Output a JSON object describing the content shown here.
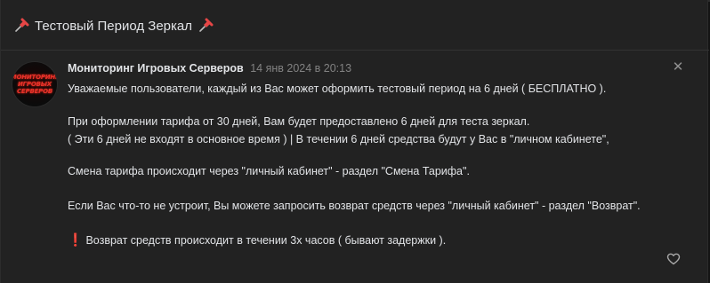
{
  "post": {
    "title": "Тестовый Период Зеркал",
    "author": "Мониторинг Игровых Серверов",
    "date": "14 янв 2024 в 20:13",
    "avatar_lines": [
      "МОНИТОРИНГ",
      "ИГРОВЫХ",
      "СЕРВЕРОВ"
    ],
    "lines": [
      "Уважаемые пользователи, каждый из Вас может оформить тестовый период на 6 дней ( БЕСПЛАТНО ).",
      "При оформлении тарифа от 30 дней, Вам будет предоставлено 6 дней для теста зеркал.",
      "( Эти 6 дней не входят в основное время ) | В течении 6 дней средства будут у Вас в \"личном кабинете\",",
      "Смена тарифа происходит через \"личный кабинет\" - раздел \"Смена Тарифа\".",
      "Если Вас что-то не устроит, Вы можете запросить возврат средств через \"личный кабинет\" - раздел \"Возврат\".",
      "Возврат средств происходит в течении 3х часов ( бывают задержки )."
    ],
    "warning_mark": "❗",
    "close_glyph": "✕"
  },
  "icons": {
    "pin": "pushpin-icon",
    "close": "close-icon",
    "like": "heart-icon",
    "warning": "exclamation-icon"
  },
  "colors": {
    "background": "#222222",
    "text": "#e1e3e6",
    "muted": "#828282",
    "pin": "#e64646",
    "avatar_text": "#e8332b"
  }
}
